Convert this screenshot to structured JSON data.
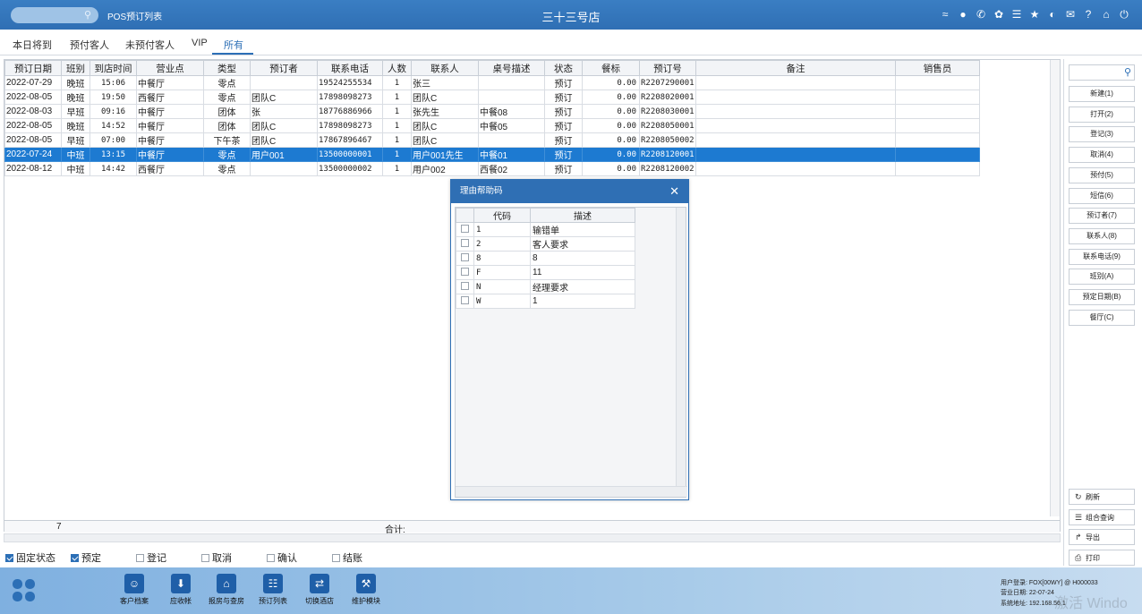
{
  "header": {
    "app_title": "POS预订列表",
    "store_title": "三十三号店",
    "icons": [
      "wifi-icon",
      "chat-icon",
      "phone-icon",
      "palette-icon",
      "menu-icon",
      "star-icon",
      "contrast-icon",
      "mail-icon",
      "help-icon",
      "home-icon",
      "power-icon"
    ]
  },
  "tabs": [
    {
      "label": "本日将到"
    },
    {
      "label": "预付客人"
    },
    {
      "label": "未预付客人"
    },
    {
      "label": "VIP"
    },
    {
      "label": "所有",
      "active": true
    }
  ],
  "table": {
    "headers": [
      "预订日期",
      "班别",
      "到店时间",
      "营业点",
      "类型",
      "预订者",
      "联系电话",
      "人数",
      "联系人",
      "桌号描述",
      "状态",
      "餐标",
      "预订号",
      "备注",
      "销售员"
    ],
    "rows": [
      [
        "2022-07-29",
        "晚班",
        "15:06",
        "中餐厅",
        "零点",
        "",
        "19524255534",
        "1",
        "张三",
        "",
        "预订",
        "0.00",
        "R2207290001",
        "",
        ""
      ],
      [
        "2022-08-05",
        "晚班",
        "19:50",
        "西餐厅",
        "零点",
        "团队C",
        "17898098273",
        "1",
        "团队C",
        "",
        "预订",
        "0.00",
        "R2208020001",
        "",
        ""
      ],
      [
        "2022-08-03",
        "早班",
        "09:16",
        "中餐厅",
        "团体",
        "张",
        "18776886966",
        "1",
        "张先生",
        "中餐08",
        "预订",
        "0.00",
        "R2208030001",
        "",
        ""
      ],
      [
        "2022-08-05",
        "晚班",
        "14:52",
        "中餐厅",
        "团体",
        "团队C",
        "17898098273",
        "1",
        "团队C",
        "中餐05",
        "预订",
        "0.00",
        "R2208050001",
        "",
        ""
      ],
      [
        "2022-08-05",
        "早班",
        "07:00",
        "中餐厅",
        "下午茶",
        "团队C",
        "17867896467",
        "1",
        "团队C",
        "",
        "预订",
        "0.00",
        "R2208050002",
        "",
        ""
      ],
      [
        "2022-07-24",
        "中班",
        "13:15",
        "中餐厅",
        "零点",
        "用户001",
        "13500000001",
        "1",
        "用户001先生",
        "中餐01",
        "预订",
        "0.00",
        "R2208120001",
        "",
        ""
      ],
      [
        "2022-08-12",
        "中班",
        "14:42",
        "西餐厅",
        "零点",
        "",
        "13500000002",
        "1",
        "用户002",
        "西餐02",
        "预订",
        "0.00",
        "R2208120002",
        "",
        ""
      ]
    ],
    "selected_row": 5,
    "footer_count": "7",
    "footer_sum_label": "合计:"
  },
  "status_checks": [
    {
      "label": "固定状态",
      "checked": true
    },
    {
      "label": "预定",
      "checked": true
    },
    {
      "label": "登记",
      "checked": false
    },
    {
      "label": "取消",
      "checked": false
    },
    {
      "label": "确认",
      "checked": false
    },
    {
      "label": "结账",
      "checked": false
    }
  ],
  "side_buttons": [
    "新建(1)",
    "打开(2)",
    "登记(3)",
    "取消(4)",
    "预付(5)",
    "短信(6)",
    "预订者(7)",
    "联系人(8)",
    "联系电话(9)",
    "班别(A)",
    "预定日期(B)",
    "餐厅(C)"
  ],
  "side_actions": [
    {
      "label": "刷新",
      "icon": "refresh-icon"
    },
    {
      "label": "组合查询",
      "icon": "list-icon"
    },
    {
      "label": "导出",
      "icon": "export-icon"
    },
    {
      "label": "打印",
      "icon": "print-icon"
    }
  ],
  "dialog": {
    "title": "理由帮助码",
    "headers": [
      "代码",
      "描述"
    ],
    "rows": [
      [
        "1",
        "输错单"
      ],
      [
        "2",
        "客人要求"
      ],
      [
        "8",
        "8"
      ],
      [
        "F",
        "11"
      ],
      [
        "N",
        "经理要求"
      ],
      [
        "W",
        "1"
      ]
    ]
  },
  "modules": [
    {
      "label": "客户档案",
      "icon": "contact-card-icon"
    },
    {
      "label": "应收帐",
      "icon": "download-icon"
    },
    {
      "label": "报房与查房",
      "icon": "house-icon"
    },
    {
      "label": "预订列表",
      "icon": "document-icon"
    },
    {
      "label": "切换酒店",
      "icon": "switch-icon"
    },
    {
      "label": "维护模块",
      "icon": "wrench-icon"
    }
  ],
  "info": {
    "user": "用户登录: FOX[00WY] @ H000033",
    "business_date": "营业日期: 22-07-24",
    "address": "系统地址: 192.168.56.1"
  },
  "watermark": "激活 Windo"
}
